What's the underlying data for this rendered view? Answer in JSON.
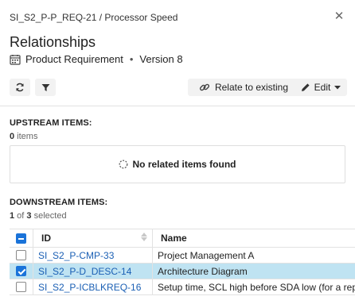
{
  "header": {
    "breadcrumb": "SI_S2_P-P_REQ-21 / Processor Speed",
    "title": "Relationships",
    "item_type": "Product Requirement",
    "separator": "•",
    "version": "Version 8"
  },
  "toolbar": {
    "relate_label": "Relate to existing",
    "edit_label": "Edit"
  },
  "upstream": {
    "title": "UPSTREAM ITEMS:",
    "count": "0",
    "count_suffix": " items",
    "empty_message": "No related items found"
  },
  "downstream": {
    "title": "DOWNSTREAM ITEMS:",
    "selected": "1",
    "of_text": " of ",
    "total": "3",
    "selected_suffix": " selected",
    "columns": {
      "id": "ID",
      "name": "Name"
    },
    "rows": [
      {
        "id": "SI_S2_P-CMP-33",
        "name": "Project Management A",
        "selected": false
      },
      {
        "id": "SI_S2_P-D_DESC-14",
        "name": "Architecture Diagram",
        "selected": true
      },
      {
        "id": "SI_S2_P-ICBLKREQ-16",
        "name": "Setup time, SCL high before SDA low (for a rep",
        "selected": false
      }
    ]
  },
  "colors": {
    "accent": "#1a73d9",
    "link": "#1a5fb4",
    "selected_row": "#bfe3f2"
  }
}
